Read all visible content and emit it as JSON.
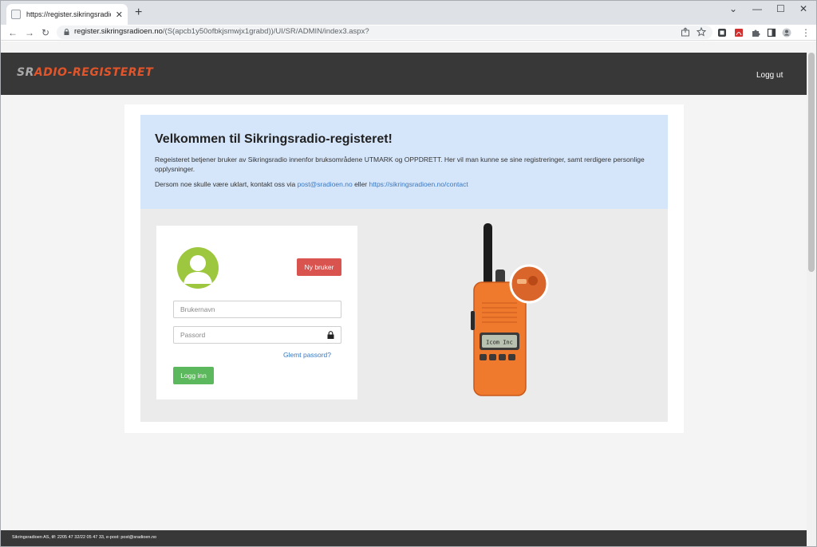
{
  "browser": {
    "tab_title": "https://register.sikringsradioen.no",
    "tab_close": "✕",
    "new_tab": "+",
    "url_host": "register.sikringsradioen.no",
    "url_path": "/(S(apcb1y50ofbkjsmwjx1grabd))/UI/SR/ADMIN/index3.aspx?",
    "nav_back": "←",
    "nav_forward": "→",
    "nav_reload": "↻",
    "win_chevron": "⌄",
    "win_minimize": "—",
    "win_maximize": "☐",
    "win_close": "✕",
    "menu": "⋮"
  },
  "header": {
    "logo_prefix": "SR",
    "logo_main": "ADIO-REGISTERET",
    "logout_label": "Logg ut"
  },
  "welcome": {
    "title": "Velkommen til Sikringsradio-registeret!",
    "paragraph1": "Regeisteret betjener bruker av Sikringsradio innenfor bruksområdene UTMARK og OPPDRETT. Her vil man kunne se sine registreringer, samt rerdigere personlige opplysninger.",
    "paragraph2_prefix": "Dersom noe skulle være uklart, kontakt oss via ",
    "email_link": "post@sradioen.no",
    "paragraph2_middle": " eller ",
    "contact_link": "https://sikringsradioen.no/contact"
  },
  "login": {
    "new_user_label": "Ny bruker",
    "username_placeholder": "Brukernavn",
    "password_placeholder": "Passord",
    "forgot_label": "Glemt passord?",
    "login_label": "Logg inn"
  },
  "radio": {
    "display_text": "Icom Inc"
  },
  "footer": {
    "text": "Sikringsradioen AS, tlf: 2205 47 32/22 05 47 33, e-post: post@sradioen.no"
  },
  "colors": {
    "header_bg": "#383838",
    "logo_orange": "#e2552a",
    "welcome_bg": "#d6e6fa",
    "new_user_red": "#d9534f",
    "login_green": "#5cb85c",
    "avatar_green": "#9dc73f",
    "link_blue": "#3a78c2",
    "radio_orange": "#ef7a2e"
  }
}
